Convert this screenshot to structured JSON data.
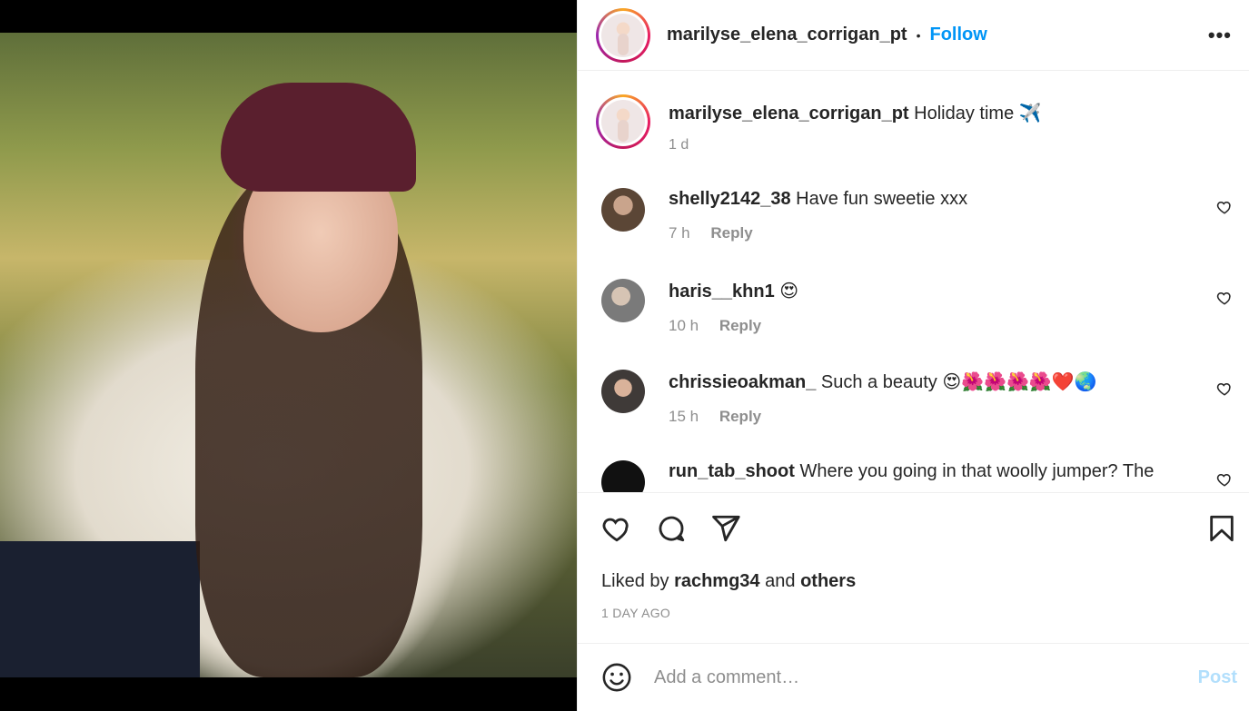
{
  "post": {
    "username": "marilyse_elena_corrigan_pt",
    "follow_label": "Follow",
    "separator": "•",
    "more_label": "•••"
  },
  "caption": {
    "username": "marilyse_elena_corrigan_pt",
    "text": "Holiday time ✈️",
    "time": "1 d"
  },
  "comments": [
    {
      "username": "shelly2142_38",
      "text": "Have fun sweetie xxx",
      "time": "7 h",
      "reply_label": "Reply",
      "avatar_color": "#5b4636"
    },
    {
      "username": "haris__khn1",
      "text": "😍",
      "time": "10 h",
      "reply_label": "Reply",
      "avatar_color": "#7a7a7a"
    },
    {
      "username": "chrissieoakman_",
      "text": "Such a beauty 😍🌺🌺🌺🌺❤️🌏",
      "time": "15 h",
      "reply_label": "Reply",
      "avatar_color": "#3f3a38"
    },
    {
      "username": "run_tab_shoot",
      "text": "Where you going in that woolly jumper? The",
      "time": "",
      "reply_label": "",
      "avatar_color": "#111111"
    }
  ],
  "likes": {
    "prefix": "Liked by",
    "user": "rachmg34",
    "conj": "and",
    "others": "others"
  },
  "posted_ago": "1 DAY AGO",
  "add_comment": {
    "placeholder": "Add a comment…",
    "post_label": "Post"
  },
  "colors": {
    "link_blue": "#0095f6",
    "post_disabled": "#b2dffc",
    "muted": "#8e8e8e"
  }
}
